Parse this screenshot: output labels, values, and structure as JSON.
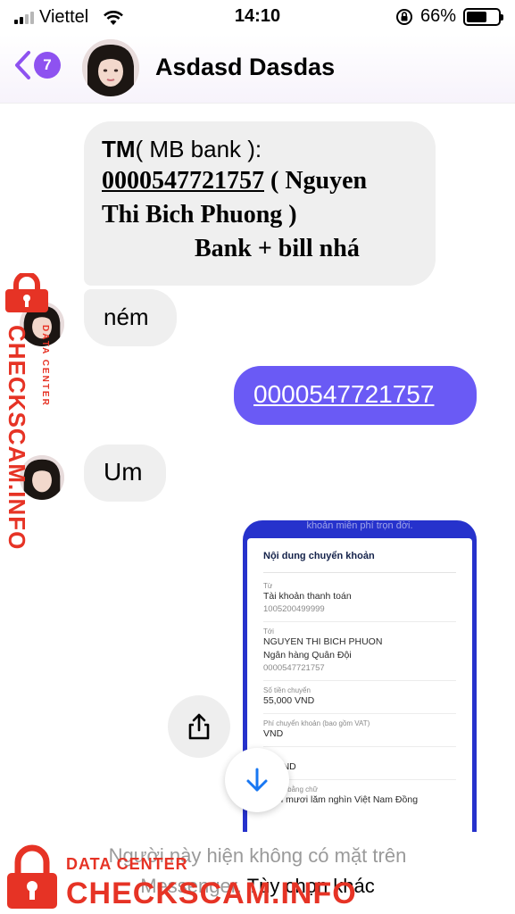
{
  "status_bar": {
    "carrier": "Viettel",
    "time": "14:10",
    "battery_percent": "66%",
    "battery_level": 0.66,
    "signal_bars": 2
  },
  "header": {
    "unread_count": "7",
    "contact_name": "Asdasd Dasdas",
    "accent_color": "#8e52f0"
  },
  "messages": {
    "m1": {
      "prefix": "TM",
      "line1_rest": "( MB bank ):",
      "account": "0000547721757",
      "name_part1": " ( Nguyen",
      "name_part2": "Thi Bich Phuong )",
      "note": "Bank + bill nhá"
    },
    "m2": {
      "text": "ném"
    },
    "m3": {
      "text": "0000547721757"
    },
    "m4": {
      "text": "Um"
    }
  },
  "receipt": {
    "top_caption": "khoản miễn phí trọn đời.",
    "title": "Nội dung chuyển khoản",
    "from_label": "Từ",
    "from_value": "Tài khoản thanh toán",
    "from_number": "1005200499999",
    "to_label": "Tới",
    "to_name": "NGUYEN THI BICH PHUON",
    "to_bank": "Ngân hàng Quân Đội",
    "to_number": "0000547721757",
    "amount_label": "Số tiền chuyển",
    "amount_value": "55,000 VND",
    "fee_label": "Phí chuyển khoản (bao gồm VAT)",
    "fee_value": "VND",
    "total_label": "iền",
    "total_value": "00 VND",
    "words_label": "Số tiền bằng chữ",
    "words_value": "Năm mươi lăm nghìn Việt Nam Đồng"
  },
  "footer": {
    "line1": "Người này hiện không có mặt trên",
    "line2_prefix": "Messenger.",
    "line2_link": "Tùy chọn khác"
  },
  "watermark": {
    "small": "DATA CENTER",
    "big": "CHECKSCAM.INFO",
    "color": "#e63325"
  },
  "icons": {
    "back": "chevron-left-icon",
    "share": "share-icon",
    "scroll_down": "arrow-down-icon",
    "lock": "lock-icon"
  }
}
